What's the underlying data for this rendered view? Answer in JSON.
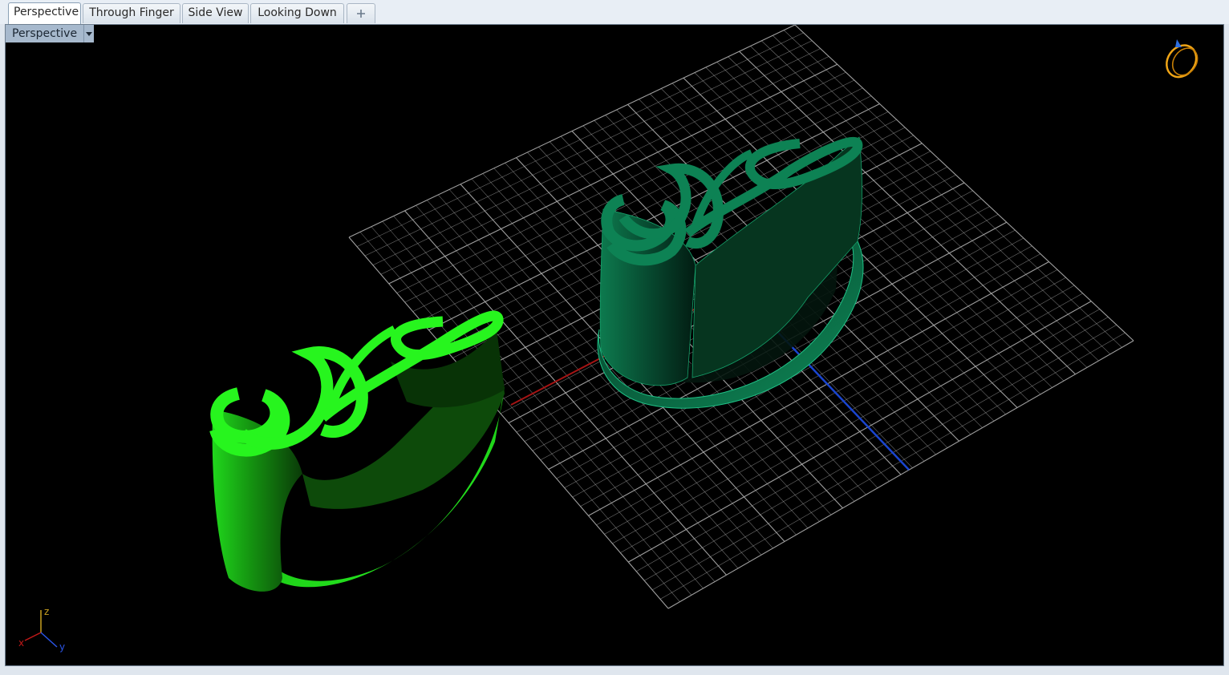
{
  "tabs": [
    {
      "label": "Perspective",
      "active": true
    },
    {
      "label": "Through Finger",
      "active": false
    },
    {
      "label": "Side View",
      "active": false
    },
    {
      "label": "Looking Down",
      "active": false
    }
  ],
  "add_tab_icon": "plus-icon",
  "viewport": {
    "label": "Perspective",
    "background": "#000000",
    "grid_color": "#a8a8a8",
    "x_axis_color": "#b01515",
    "y_axis_color": "#1740c8",
    "render_color": "#22f01a",
    "ghost_color": "#0b7a4d"
  },
  "axis_gizmo": {
    "x_label": "x",
    "y_label": "y",
    "z_label": "z"
  },
  "nav_icon": "ring-navigation-icon"
}
